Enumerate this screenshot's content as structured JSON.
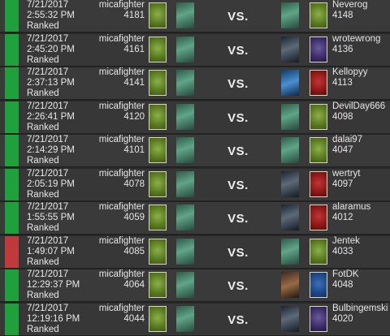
{
  "vs_label": "VS.",
  "colors": {
    "win": "#1ea03a",
    "loss": "#c0393d"
  },
  "matches": [
    {
      "result": "win",
      "date": "7/21/2017",
      "time": "2:55:32 PM",
      "mode": "Ranked",
      "player": "micafighter",
      "player_rating": "4181",
      "player_faction": "monsters",
      "opponent": "Neverog",
      "opponent_rating": "4148",
      "opponent_leader": "green",
      "opponent_faction": "monsters"
    },
    {
      "result": "win",
      "date": "7/21/2017",
      "time": "2:45:20 PM",
      "mode": "Ranked",
      "player": "micafighter",
      "player_rating": "4161",
      "player_faction": "monsters",
      "opponent": "wrotewrong",
      "opponent_rating": "4136",
      "opponent_leader": "dark",
      "opponent_faction": "skellige"
    },
    {
      "result": "win",
      "date": "7/21/2017",
      "time": "2:37:13 PM",
      "mode": "Ranked",
      "player": "micafighter",
      "player_rating": "4141",
      "player_faction": "monsters",
      "opponent": "Kellopyy",
      "opponent_rating": "4113",
      "opponent_leader": "blue",
      "opponent_faction": "nilfgaard"
    },
    {
      "result": "win",
      "date": "7/21/2017",
      "time": "2:26:41 PM",
      "mode": "Ranked",
      "player": "micafighter",
      "player_rating": "4120",
      "player_faction": "monsters",
      "opponent": "DevilDay666",
      "opponent_rating": "4098",
      "opponent_leader": "green",
      "opponent_faction": "monsters"
    },
    {
      "result": "win",
      "date": "7/21/2017",
      "time": "2:14:29 PM",
      "mode": "Ranked",
      "player": "micafighter",
      "player_rating": "4101",
      "player_faction": "monsters",
      "opponent": "dalai97",
      "opponent_rating": "4047",
      "opponent_leader": "green",
      "opponent_faction": "monsters"
    },
    {
      "result": "win",
      "date": "7/21/2017",
      "time": "2:05:19 PM",
      "mode": "Ranked",
      "player": "micafighter",
      "player_rating": "4078",
      "player_faction": "monsters",
      "opponent": "wertryt",
      "opponent_rating": "4097",
      "opponent_leader": "dark",
      "opponent_faction": "nilfgaard"
    },
    {
      "result": "win",
      "date": "7/21/2017",
      "time": "1:55:55 PM",
      "mode": "Ranked",
      "player": "micafighter",
      "player_rating": "4059",
      "player_faction": "monsters",
      "opponent": "alaramus",
      "opponent_rating": "4012",
      "opponent_leader": "dark",
      "opponent_faction": "nilfgaard"
    },
    {
      "result": "loss",
      "date": "7/21/2017",
      "time": "1:49:07 PM",
      "mode": "Ranked",
      "player": "micafighter",
      "player_rating": "4085",
      "player_faction": "monsters",
      "opponent": "Jentek",
      "opponent_rating": "4033",
      "opponent_leader": "green",
      "opponent_faction": "monsters"
    },
    {
      "result": "win",
      "date": "7/21/2017",
      "time": "12:29:37 PM",
      "mode": "Ranked",
      "player": "micafighter",
      "player_rating": "4064",
      "player_faction": "monsters",
      "opponent": "FotDK",
      "opponent_rating": "4048",
      "opponent_leader": "warm",
      "opponent_faction": "northern"
    },
    {
      "result": "win",
      "date": "7/21/2017",
      "time": "12:19:16 PM",
      "mode": "Ranked",
      "player": "micafighter",
      "player_rating": "4044",
      "player_faction": "monsters",
      "opponent": "Bulbingemski",
      "opponent_rating": "4020",
      "opponent_leader": "dark",
      "opponent_faction": "skellige"
    }
  ]
}
